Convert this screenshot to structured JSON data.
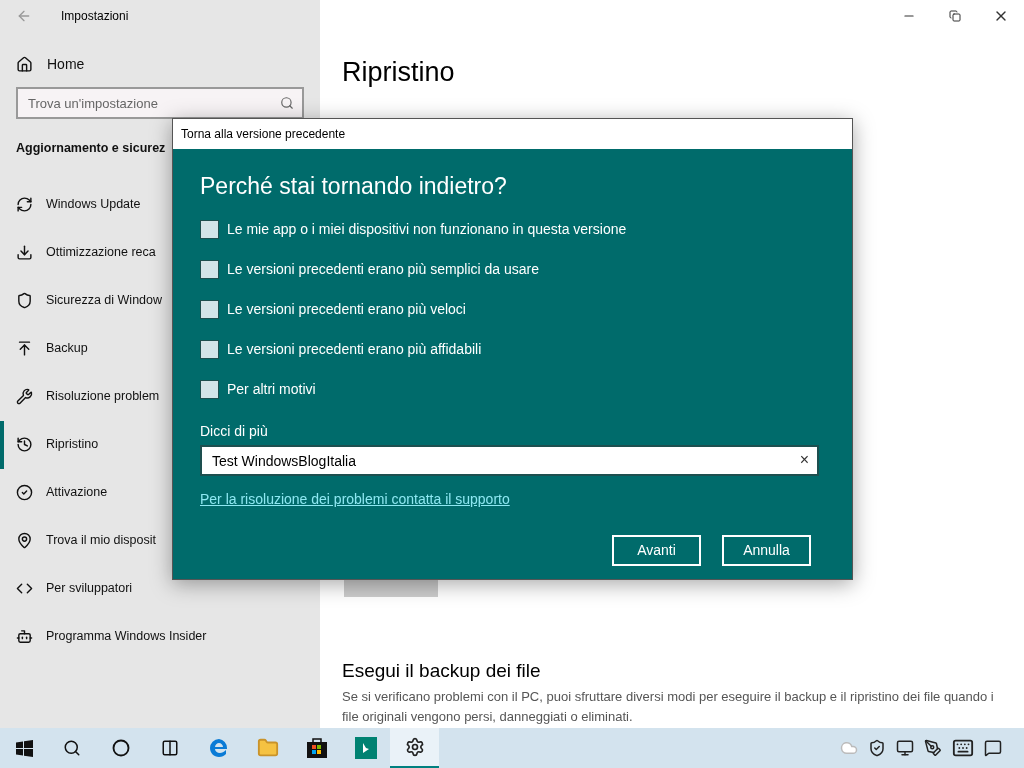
{
  "window": {
    "title": "Impostazioni"
  },
  "sidebar": {
    "home": "Home",
    "search": {
      "placeholder": "Trova un'impostazione"
    },
    "section": "Aggiornamento e sicurez",
    "items": [
      {
        "label": "Windows Update",
        "selected": false
      },
      {
        "label": "Ottimizzazione reca",
        "selected": false
      },
      {
        "label": "Sicurezza di Window",
        "selected": false
      },
      {
        "label": "Backup",
        "selected": false
      },
      {
        "label": "Risoluzione problem",
        "selected": false
      },
      {
        "label": "Ripristino",
        "selected": true
      },
      {
        "label": "Attivazione",
        "selected": false
      },
      {
        "label": "Trova il mio disposit",
        "selected": false
      },
      {
        "label": "Per sviluppatori",
        "selected": false
      },
      {
        "label": "Programma Windows Insider",
        "selected": false
      }
    ]
  },
  "content": {
    "title": "Ripristino",
    "section_2": {
      "title": "Esegui il backup dei file",
      "text": "Se si verificano problemi con il PC, puoi sfruttare diversi modi per eseguire il backup e il ripristino dei file quando i file originali vengono persi, danneggiati o eliminati."
    }
  },
  "dialog": {
    "title": "Torna alla versione precedente",
    "heading": "Perché stai tornando indietro?",
    "options": [
      {
        "label": "Le mie app o i miei dispositivi non funzionano in questa versione",
        "checked": false
      },
      {
        "label": "Le versioni precedenti erano più semplici da usare",
        "checked": false
      },
      {
        "label": "Le versioni precedenti erano più veloci",
        "checked": false
      },
      {
        "label": "Le versioni precedenti erano più affidabili",
        "checked": false
      },
      {
        "label": "Per altri motivi",
        "checked": false
      }
    ],
    "more_label": "Dicci di più",
    "more_value": "Test WindowsBlogItalia",
    "clear": "×",
    "link": "Per la risoluzione dei problemi contatta il supporto",
    "buttons": [
      "Avanti",
      "Annulla"
    ]
  },
  "taskbar": {
    "apps": [
      {
        "active": false
      },
      {
        "active": false
      },
      {
        "active": false
      },
      {
        "active": false
      },
      {
        "active": false
      },
      {
        "active": false
      },
      {
        "active": false
      },
      {
        "active": true
      }
    ]
  }
}
